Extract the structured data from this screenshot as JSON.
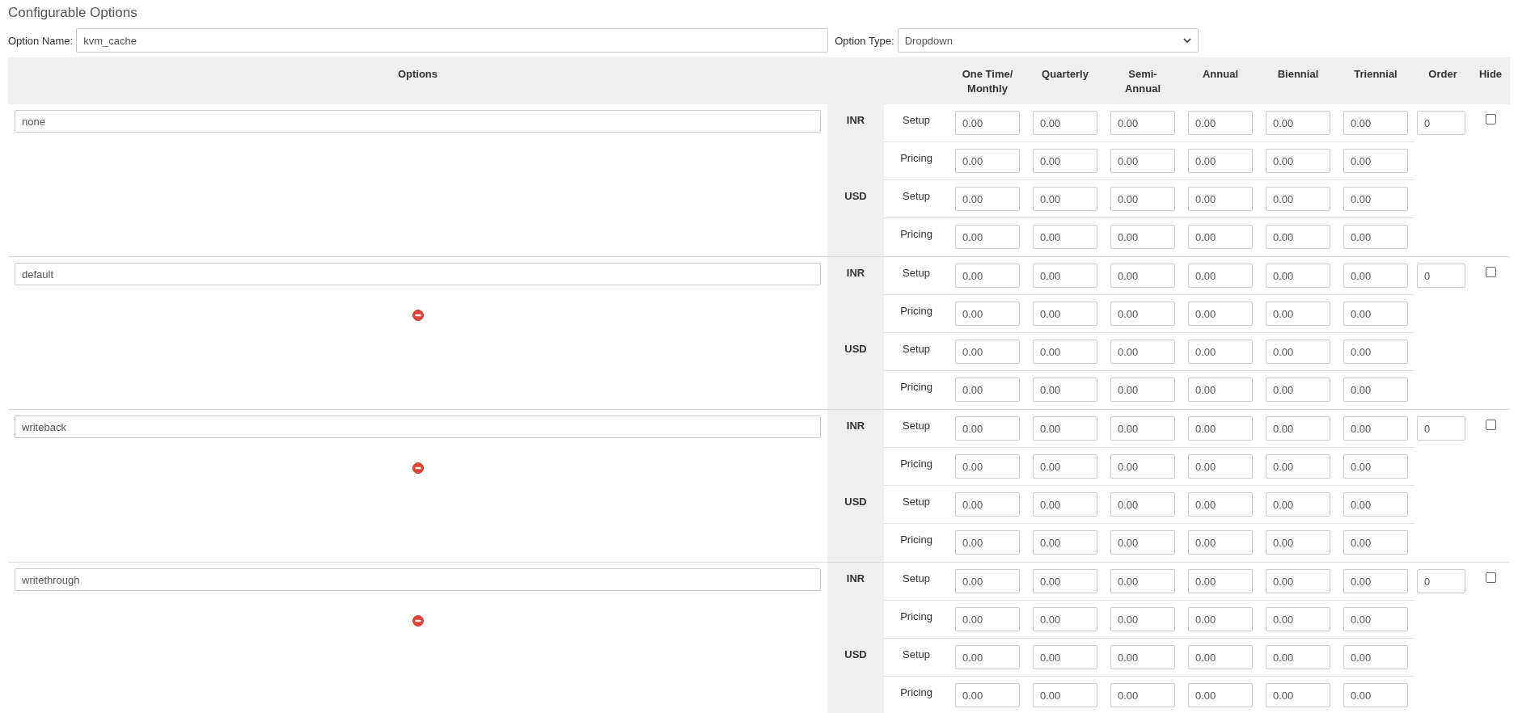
{
  "title": "Configurable Options",
  "option_name": {
    "label": "Option Name:",
    "value": "kvm_cache"
  },
  "option_type": {
    "label": "Option Type:",
    "value": "Dropdown"
  },
  "table": {
    "options_header": "Options",
    "columns": [
      "One Time/ Monthly",
      "Quarterly",
      "Semi- Annual",
      "Annual",
      "Biennial",
      "Triennial"
    ],
    "order_header": "Order",
    "hide_header": "Hide"
  },
  "options": [
    {
      "name": "none",
      "removable": false,
      "order": "0",
      "hide": false,
      "currencies": [
        {
          "code": "INR",
          "rows": [
            {
              "label": "Setup",
              "values": [
                "0.00",
                "0.00",
                "0.00",
                "0.00",
                "0.00",
                "0.00"
              ]
            },
            {
              "label": "Pricing",
              "values": [
                "0.00",
                "0.00",
                "0.00",
                "0.00",
                "0.00",
                "0.00"
              ]
            }
          ]
        },
        {
          "code": "USD",
          "rows": [
            {
              "label": "Setup",
              "values": [
                "0.00",
                "0.00",
                "0.00",
                "0.00",
                "0.00",
                "0.00"
              ]
            },
            {
              "label": "Pricing",
              "values": [
                "0.00",
                "0.00",
                "0.00",
                "0.00",
                "0.00",
                "0.00"
              ]
            }
          ]
        }
      ]
    },
    {
      "name": "default",
      "removable": true,
      "order": "0",
      "hide": false,
      "currencies": [
        {
          "code": "INR",
          "rows": [
            {
              "label": "Setup",
              "values": [
                "0.00",
                "0.00",
                "0.00",
                "0.00",
                "0.00",
                "0.00"
              ]
            },
            {
              "label": "Pricing",
              "values": [
                "0.00",
                "0.00",
                "0.00",
                "0.00",
                "0.00",
                "0.00"
              ]
            }
          ]
        },
        {
          "code": "USD",
          "rows": [
            {
              "label": "Setup",
              "values": [
                "0.00",
                "0.00",
                "0.00",
                "0.00",
                "0.00",
                "0.00"
              ]
            },
            {
              "label": "Pricing",
              "values": [
                "0.00",
                "0.00",
                "0.00",
                "0.00",
                "0.00",
                "0.00"
              ]
            }
          ]
        }
      ]
    },
    {
      "name": "writeback",
      "removable": true,
      "order": "0",
      "hide": false,
      "currencies": [
        {
          "code": "INR",
          "rows": [
            {
              "label": "Setup",
              "values": [
                "0.00",
                "0.00",
                "0.00",
                "0.00",
                "0.00",
                "0.00"
              ]
            },
            {
              "label": "Pricing",
              "values": [
                "0.00",
                "0.00",
                "0.00",
                "0.00",
                "0.00",
                "0.00"
              ]
            }
          ]
        },
        {
          "code": "USD",
          "rows": [
            {
              "label": "Setup",
              "values": [
                "0.00",
                "0.00",
                "0.00",
                "0.00",
                "0.00",
                "0.00"
              ]
            },
            {
              "label": "Pricing",
              "values": [
                "0.00",
                "0.00",
                "0.00",
                "0.00",
                "0.00",
                "0.00"
              ]
            }
          ]
        }
      ]
    },
    {
      "name": "writethrough",
      "removable": true,
      "order": "0",
      "hide": false,
      "currencies": [
        {
          "code": "INR",
          "rows": [
            {
              "label": "Setup",
              "values": [
                "0.00",
                "0.00",
                "0.00",
                "0.00",
                "0.00",
                "0.00"
              ]
            },
            {
              "label": "Pricing",
              "values": [
                "0.00",
                "0.00",
                "0.00",
                "0.00",
                "0.00",
                "0.00"
              ]
            }
          ]
        },
        {
          "code": "USD",
          "rows": [
            {
              "label": "Setup",
              "values": [
                "0.00",
                "0.00",
                "0.00",
                "0.00",
                "0.00",
                "0.00"
              ]
            },
            {
              "label": "Pricing",
              "values": [
                "0.00",
                "0.00",
                "0.00",
                "0.00",
                "0.00",
                "0.00"
              ]
            }
          ]
        }
      ]
    }
  ]
}
